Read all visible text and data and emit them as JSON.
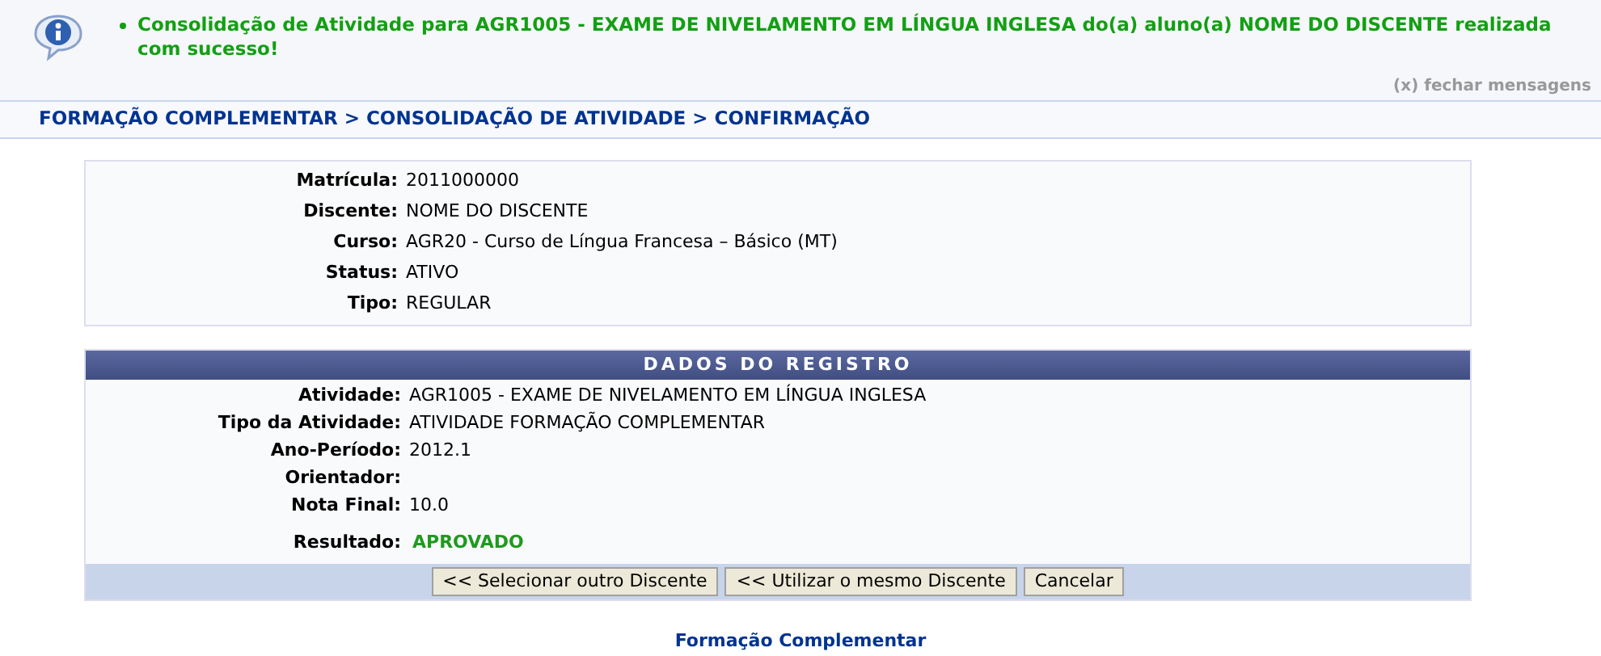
{
  "message": {
    "text": "Consolidação de Atividade para AGR1005 - EXAME DE NIVELAMENTO EM LÍNGUA INGLESA do(a) aluno(a) NOME DO DISCENTE realizada com sucesso!",
    "close": "(x) fechar mensagens"
  },
  "breadcrumb": "FORMAÇÃO COMPLEMENTAR > CONSOLIDAÇÃO DE ATIVIDADE > CONFIRMAÇÃO",
  "student": [
    {
      "label": "Matrícula:",
      "value": "2011000000"
    },
    {
      "label": "Discente:",
      "value": "NOME DO DISCENTE"
    },
    {
      "label": "Curso:",
      "value": "AGR20 - Curso de Língua Francesa – Básico (MT)"
    },
    {
      "label": "Status:",
      "value": "ATIVO"
    },
    {
      "label": "Tipo:",
      "value": "REGULAR"
    }
  ],
  "record": {
    "title": "DADOS DO REGISTRO",
    "rows": [
      {
        "label": "Atividade:",
        "value": "AGR1005 - EXAME DE NIVELAMENTO EM LÍNGUA INGLESA"
      },
      {
        "label": "Tipo da Atividade:",
        "value": "ATIVIDADE FORMAÇÃO COMPLEMENTAR"
      },
      {
        "label": "Ano-Período:",
        "value": "2012.1"
      },
      {
        "label": "Orientador:"
      },
      {
        "label": "Nota Final:",
        "value": "10.0"
      }
    ],
    "result": {
      "label": "Resultado:",
      "value": "APROVADO"
    },
    "buttons": [
      "<< Selecionar outro Discente",
      "<< Utilizar o mesmo Discente",
      "Cancelar"
    ]
  },
  "footer_link": "Formação Complementar"
}
